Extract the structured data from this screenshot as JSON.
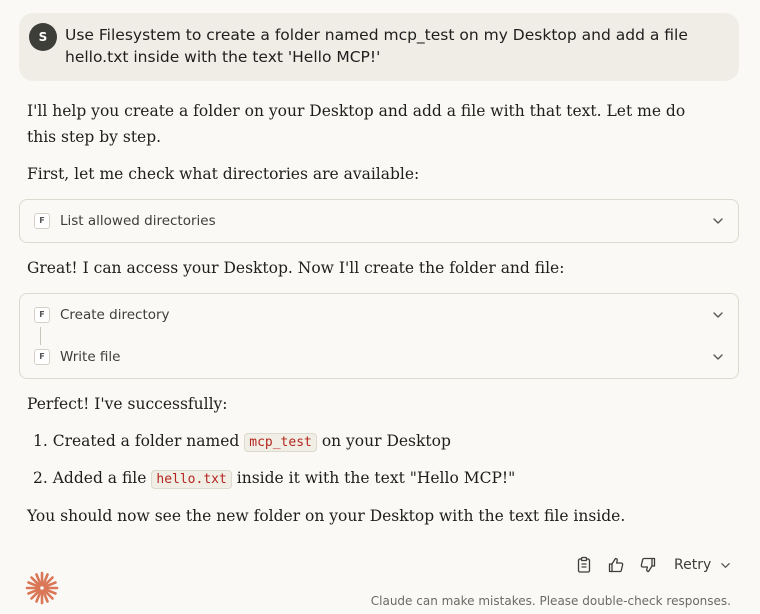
{
  "user_message": {
    "avatar_initial": "S",
    "text": "Use Filesystem to create a folder named mcp_test on my Desktop and add a file hello.txt inside with the text 'Hello MCP!'"
  },
  "assistant": {
    "intro": "I'll help you create a folder on your Desktop and add a file with that text. Let me do this step by step.",
    "check_dirs": "First, let me check what directories are available:",
    "tool_group_1": [
      {
        "badge": "F",
        "label": "List allowed directories",
        "icon": "chevron-down-icon"
      }
    ],
    "access_note": "Great! I can access your Desktop. Now I'll create the folder and file:",
    "tool_group_2": [
      {
        "badge": "F",
        "label": "Create directory",
        "icon": "chevron-down-icon"
      },
      {
        "badge": "F",
        "label": "Write file",
        "icon": "chevron-down-icon"
      }
    ],
    "success_intro": "Perfect! I've successfully:",
    "steps": [
      {
        "num": "1.",
        "before": "Created a folder named",
        "code": "mcp_test",
        "after": "on your Desktop"
      },
      {
        "num": "2.",
        "before": "Added a file",
        "code": "hello.txt",
        "after": "inside it with the text \"Hello MCP!\""
      }
    ],
    "closing": "You should now see the new folder on your Desktop with the text file inside."
  },
  "actions": {
    "copy_icon": "clipboard-icon",
    "thumbs_up_icon": "thumbs-up-icon",
    "thumbs_down_icon": "thumbs-down-icon",
    "retry_label": "Retry"
  },
  "footer": {
    "logo_icon": "claude-starburst-logo",
    "disclaimer": "Claude can make mistakes. Please double-check responses."
  },
  "colors": {
    "background": "#faf9f5",
    "user_bubble": "#efede6",
    "brand_accent": "#d97757",
    "inline_code_text": "#b3261e"
  }
}
